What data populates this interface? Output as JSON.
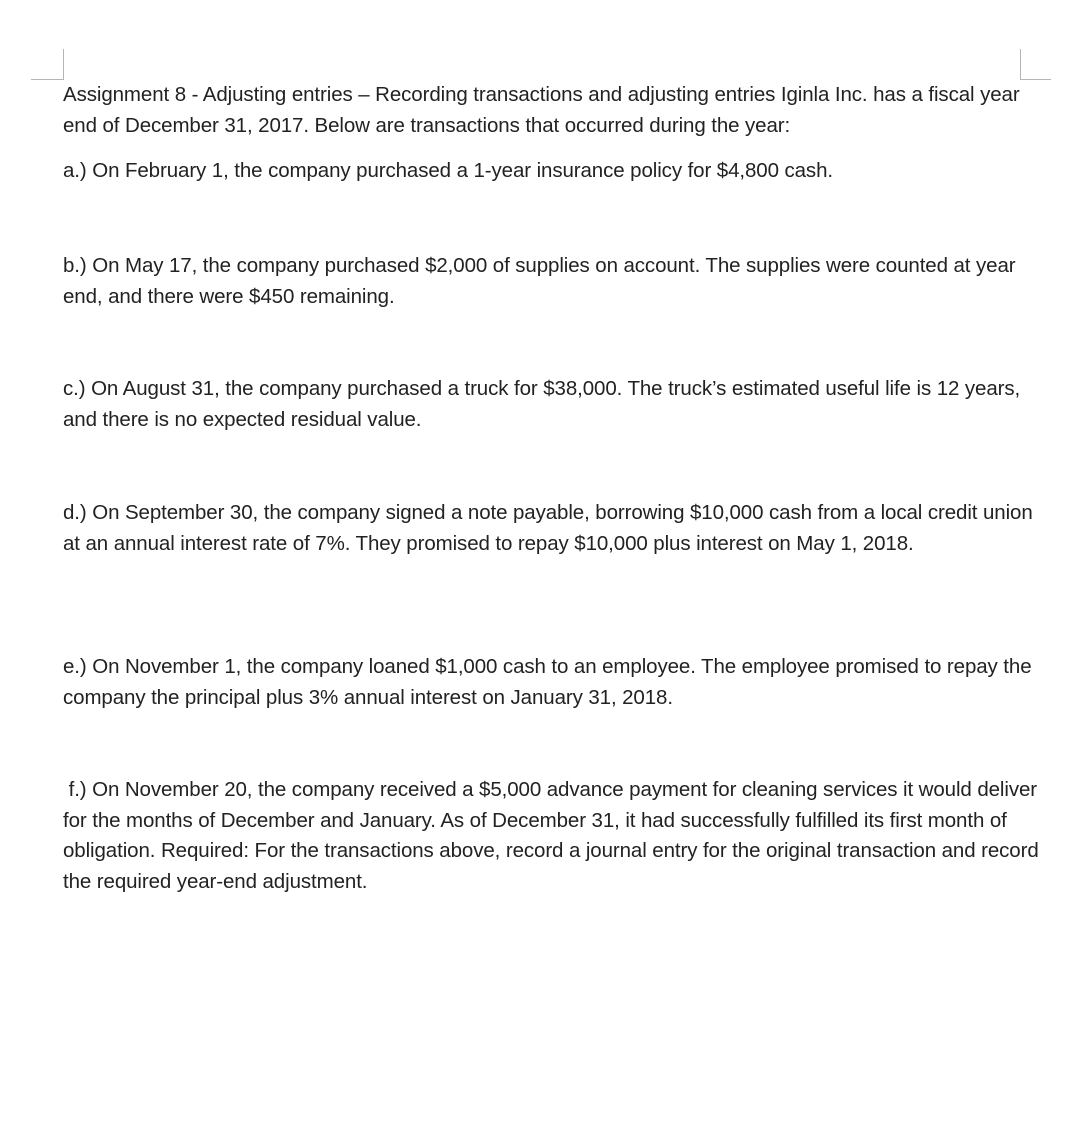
{
  "document": {
    "title_paragraph": "Assignment 8 - Adjusting entries – Recording transactions and adjusting entries Iginla Inc. has a fiscal year end of December 31, 2017. Below are transactions that occurred during the year:",
    "items": [
      {
        "label": "a.)",
        "text": "a.) On February 1, the company purchased a 1-year insurance policy for $4,800 cash."
      },
      {
        "label": "b.)",
        "text": "b.) On May 17, the company purchased $2,000 of supplies on account. The supplies were counted at year end, and there were $450 remaining."
      },
      {
        "label": "c.)",
        "text": "c.) On August 31, the company purchased a truck for $38,000. The truck’s estimated useful life is 12 years, and there is no expected residual value."
      },
      {
        "label": "d.)",
        "text": "d.) On September 30, the company signed a note payable, borrowing $10,000 cash from a local credit union at an annual interest rate of 7%. They promised to repay $10,000 plus interest on May 1, 2018."
      },
      {
        "label": "e.)",
        "text": "e.) On November 1, the company loaned $1,000 cash to an employee. The employee promised to repay the company the principal plus 3% annual interest on January 31, 2018."
      },
      {
        "label": "f.)",
        "text": " f.) On November 20, the company received a $5,000 advance payment for cleaning services it would deliver for the months of December and January. As of December 31, it had successfully fulfilled its first month of obligation. Required: For the transactions above, record a journal entry for the original transaction and record the required year-end adjustment."
      }
    ]
  }
}
